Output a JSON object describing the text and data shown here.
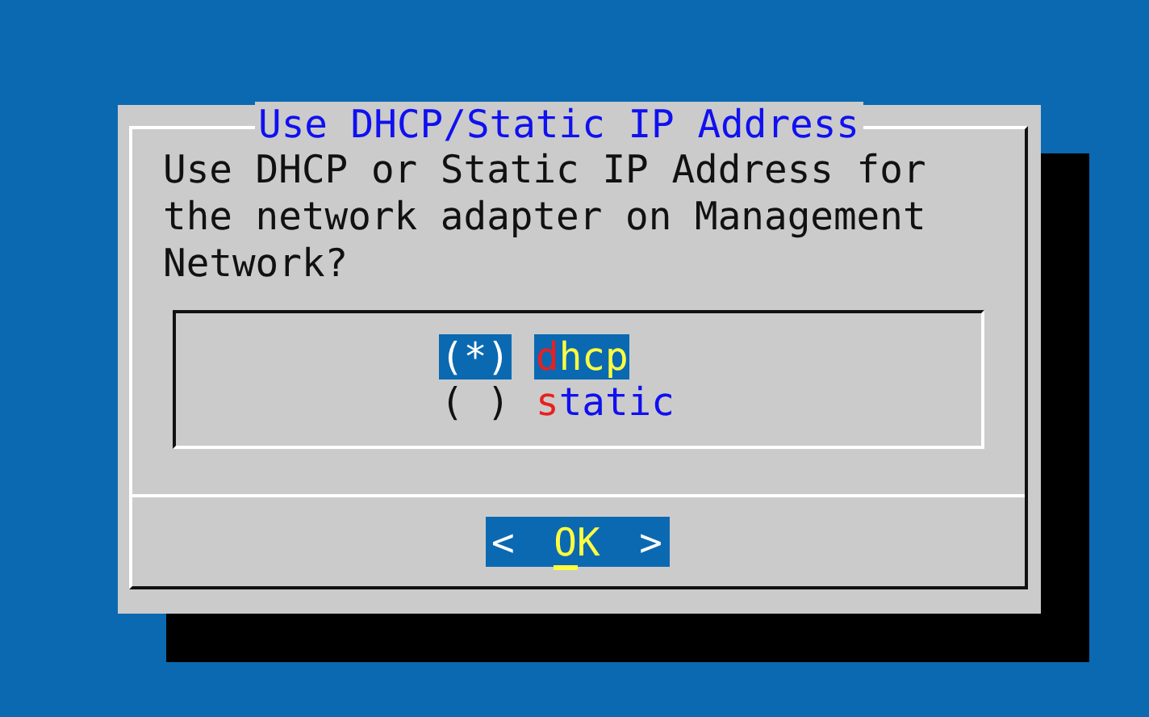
{
  "dialog": {
    "title": "Use DHCP/Static IP Address",
    "message": "Use DHCP or Static IP Address for the network adapter on Management Network?",
    "options": [
      {
        "marker": "(*)",
        "label": "dhcp",
        "selected": true
      },
      {
        "marker": "( )",
        "label": "static",
        "selected": false
      }
    ],
    "button": {
      "open": "<",
      "label": "OK",
      "close": ">",
      "selected": true
    }
  }
}
